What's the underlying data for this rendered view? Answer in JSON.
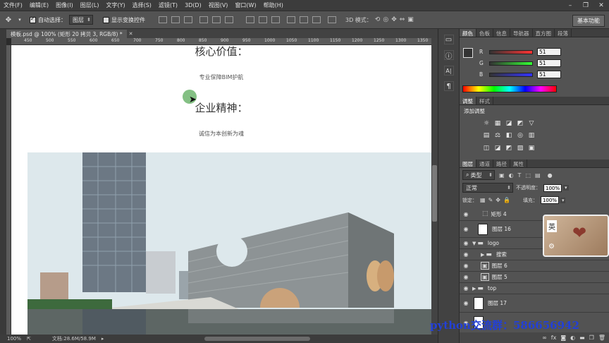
{
  "menu": [
    "文件(F)",
    "编辑(E)",
    "图像(I)",
    "图层(L)",
    "文字(Y)",
    "选择(S)",
    "滤镜(T)",
    "3D(D)",
    "视图(V)",
    "窗口(W)",
    "帮助(H)"
  ],
  "options": {
    "auto_select_label": "自动选择：",
    "auto_select_target": "图层",
    "show_transform_label": "显示变换控件",
    "mode_3d_label": "3D 模式：",
    "workspace": "基本功能"
  },
  "document": {
    "tab_title": "模板.psd @ 100% (矩形 20 拷贝 3, RGB/8) *",
    "ruler_numbers": [
      "450",
      "500",
      "550",
      "600",
      "650",
      "700",
      "750",
      "800",
      "850",
      "900",
      "950",
      "1000",
      "1050",
      "1100",
      "1150",
      "1200",
      "1250",
      "1300",
      "1350"
    ],
    "heading1": "核心价值：",
    "sub1": "专业保障BIM护航",
    "heading2": "企业精神：",
    "sub2": "诚信为本创新为魂"
  },
  "status": {
    "zoom": "100%",
    "doc_info": "文档:28.6M/58.9M"
  },
  "color_panel": {
    "tabs": [
      "颜色",
      "色板",
      "信息",
      "导航器",
      "直方图",
      "段落"
    ],
    "channels": [
      {
        "label": "R",
        "value": "51"
      },
      {
        "label": "G",
        "value": "51"
      },
      {
        "label": "B",
        "value": "51"
      }
    ]
  },
  "adjust_panel": {
    "tabs": [
      "调整",
      "样式"
    ],
    "title": "添加调整",
    "icons_row1": [
      "☼",
      "▦",
      "◪",
      "◩",
      "▽"
    ],
    "icons_row2": [
      "▤",
      "⚖",
      "◧",
      "◎",
      "▥"
    ],
    "icons_row3": [
      "◫",
      "◪",
      "◩",
      "▨",
      "▣"
    ]
  },
  "layers_panel": {
    "tabs": [
      "图层",
      "通道",
      "路径",
      "属性"
    ],
    "filter_kind": "类型",
    "blend_mode": "正常",
    "opacity_label": "不透明度：",
    "opacity": "100%",
    "lock_label": "锁定：",
    "fill_label": "填充：",
    "fill": "100%",
    "layers": [
      {
        "name": "矩形 4",
        "kind": "shape"
      },
      {
        "name": "图层 16",
        "kind": "pixel"
      },
      {
        "name": "logo",
        "kind": "group",
        "open": true
      },
      {
        "name": "搜索",
        "kind": "group"
      },
      {
        "name": "图层 6",
        "kind": "smart"
      },
      {
        "name": "图层 5",
        "kind": "smart"
      },
      {
        "name": "top",
        "kind": "group"
      },
      {
        "name": "图层 17",
        "kind": "pixel"
      }
    ]
  },
  "ime_label": "英",
  "watermark": "python交流群：586656942"
}
